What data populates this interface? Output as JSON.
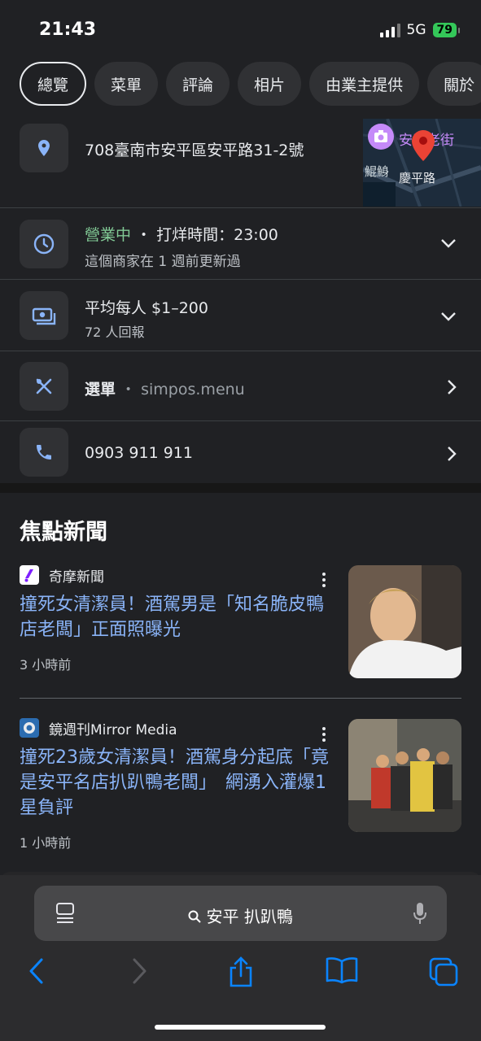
{
  "status": {
    "time": "21:43",
    "network": "5G",
    "battery": "79"
  },
  "tabs": [
    "總覽",
    "菜單",
    "評論",
    "相片",
    "由業主提供",
    "關於"
  ],
  "address": {
    "text": "708臺南市安平區安平路31-2號",
    "map_label_1": "安平老街",
    "map_label_2": "鯤鯓",
    "map_label_3": "慶平路"
  },
  "hours": {
    "status": "營業中",
    "sep": "・",
    "closing": "打烊時間：23:00",
    "updated": "這個商家在 1 週前更新過"
  },
  "price": {
    "title": "平均每人 $1–200",
    "reports": "72 人回報"
  },
  "menu": {
    "label": "選單",
    "sep": "・",
    "url": "simpos.menu"
  },
  "phone": {
    "number": "0903 911 911"
  },
  "news_section": {
    "title": "焦點新聞"
  },
  "news": [
    {
      "source": "奇摩新聞",
      "headline": "撞死女清潔員！酒駕男是「知名脆皮鴨店老闆」正面照曝光",
      "age": "3 小時前"
    },
    {
      "source": "鏡週刊Mirror Media",
      "headline": "撞死23歲女清潔員！酒駕身分起底「竟是安平名店扒趴鴨老闆」　網湧入灌爆1星負評",
      "age": "1 小時前"
    }
  ],
  "search": {
    "query": "安平 扒趴鴨"
  },
  "colors": {
    "accent": "#8ab4f8",
    "open_green": "#81c995",
    "safari_blue": "#0a84ff",
    "background": "#202124"
  }
}
